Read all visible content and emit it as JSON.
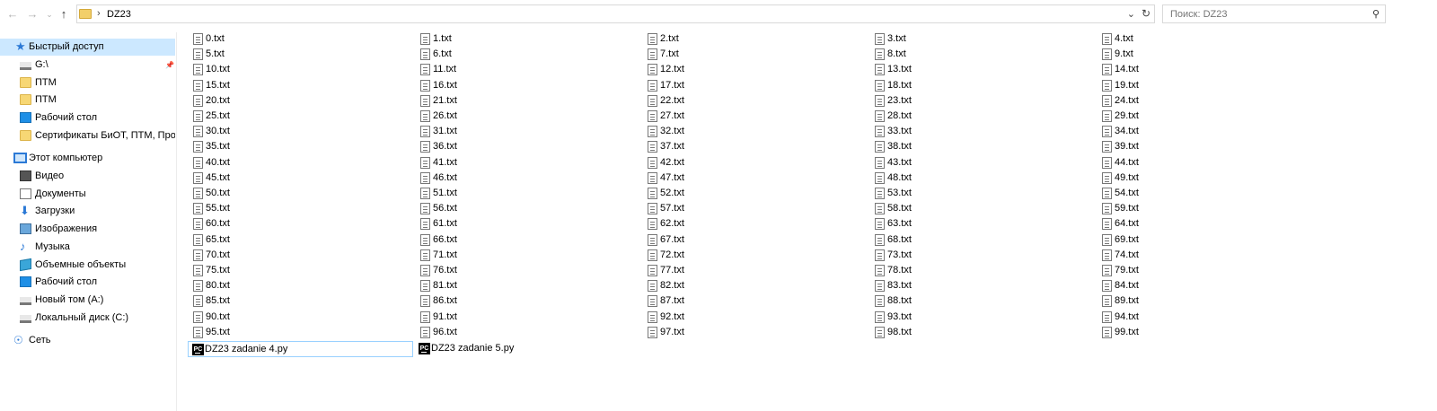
{
  "address": {
    "path": "DZ23",
    "separator": "›"
  },
  "search": {
    "placeholder": "Поиск: DZ23"
  },
  "sidebar": {
    "quick_access": "Быстрый доступ",
    "quick_items": [
      {
        "label": "G:\\",
        "icon": "drive-icon"
      },
      {
        "label": "ПТМ",
        "icon": "folder-icon"
      },
      {
        "label": "ПТМ",
        "icon": "folder-icon"
      },
      {
        "label": "Рабочий стол",
        "icon": "desktop-icon"
      },
      {
        "label": "Сертификаты БиОТ, ПТМ, ПромБе",
        "icon": "folder-icon"
      }
    ],
    "this_pc": "Этот компьютер",
    "pc_items": [
      {
        "label": "Видео",
        "icon": "video-icon"
      },
      {
        "label": "Документы",
        "icon": "documents-icon"
      },
      {
        "label": "Загрузки",
        "icon": "downloads-icon"
      },
      {
        "label": "Изображения",
        "icon": "pictures-icon"
      },
      {
        "label": "Музыка",
        "icon": "music-icon"
      },
      {
        "label": "Объемные объекты",
        "icon": "3d-objects-icon"
      },
      {
        "label": "Рабочий стол",
        "icon": "desktop-icon"
      },
      {
        "label": "Новый том (A:)",
        "icon": "drive-icon"
      },
      {
        "label": "Локальный диск (C:)",
        "icon": "drive-icon"
      }
    ],
    "network": "Сеть"
  },
  "files": {
    "txt_count": 100,
    "txt_ext": ".txt",
    "columns": 5,
    "py_files": [
      {
        "name": "DZ23 zadanie 4.py",
        "icon_text": "PC"
      },
      {
        "name": "DZ23 zadanie 5.py",
        "icon_text": "PC"
      }
    ]
  },
  "colors": {
    "selection": "#cce8ff",
    "focus_border": "#99d1ff",
    "accent": "#2b79d6"
  }
}
